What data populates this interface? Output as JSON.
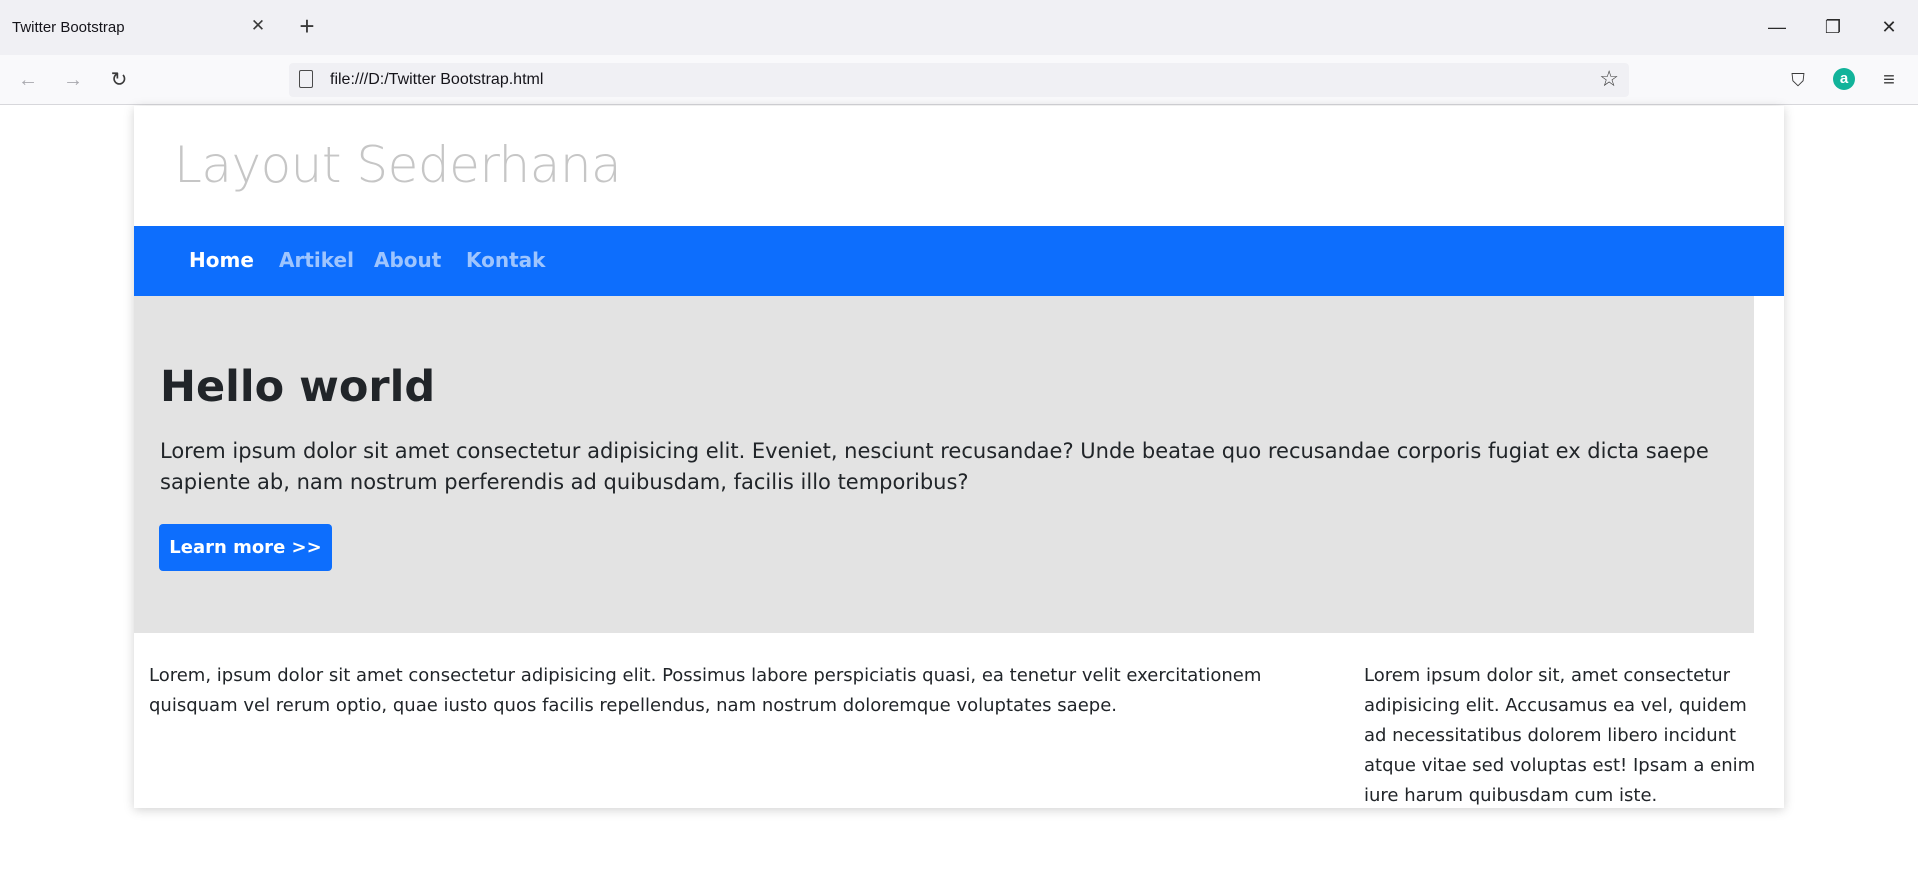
{
  "browser": {
    "tab_title": "Twitter Bootstrap",
    "tab_close": "✕",
    "new_tab": "+",
    "url": "file:///D:/Twitter Bootstrap.html",
    "window_controls": {
      "minimize": "—",
      "restore": "❐",
      "close": "✕"
    },
    "icons": {
      "back": "←",
      "forward": "→",
      "reload": "↻",
      "star": "☆",
      "pocket": "⛉",
      "extension": "a",
      "menu": "≡"
    }
  },
  "site": {
    "title": "Layout Sederhana",
    "nav": [
      {
        "label": "Home",
        "active": true
      },
      {
        "label": "Artikel",
        "active": false
      },
      {
        "label": "About",
        "active": false
      },
      {
        "label": "Kontak",
        "active": false
      }
    ],
    "jumbotron": {
      "heading": "Hello world",
      "text": "Lorem ipsum dolor sit amet consectetur adipisicing elit. Eveniet, nesciunt recusandae? Unde beatae quo recusandae corporis fugiat ex dicta saepe sapiente ab, nam nostrum perferendis ad quibusdam, facilis illo temporibus?",
      "button": "Learn more >>"
    },
    "content": {
      "left": "Lorem, ipsum dolor sit amet consectetur adipisicing elit. Possimus labore perspiciatis quasi, ea tenetur velit exercitationem quisquam vel rerum optio, quae iusto quos facilis repellendus, nam nostrum doloremque voluptates saepe.",
      "right": "Lorem ipsum dolor sit, amet consectetur adipisicing elit. Accusamus ea vel, quidem ad necessitatibus dolorem libero incidunt atque vitae sed voluptas est! Ipsam a enim iure harum quibusdam cum iste."
    }
  },
  "colors": {
    "nav_bg": "#0d6efd",
    "jumbotron_bg": "#e3e3e3",
    "button_bg": "#0d6efd",
    "title_color": "#c6c6c6"
  }
}
